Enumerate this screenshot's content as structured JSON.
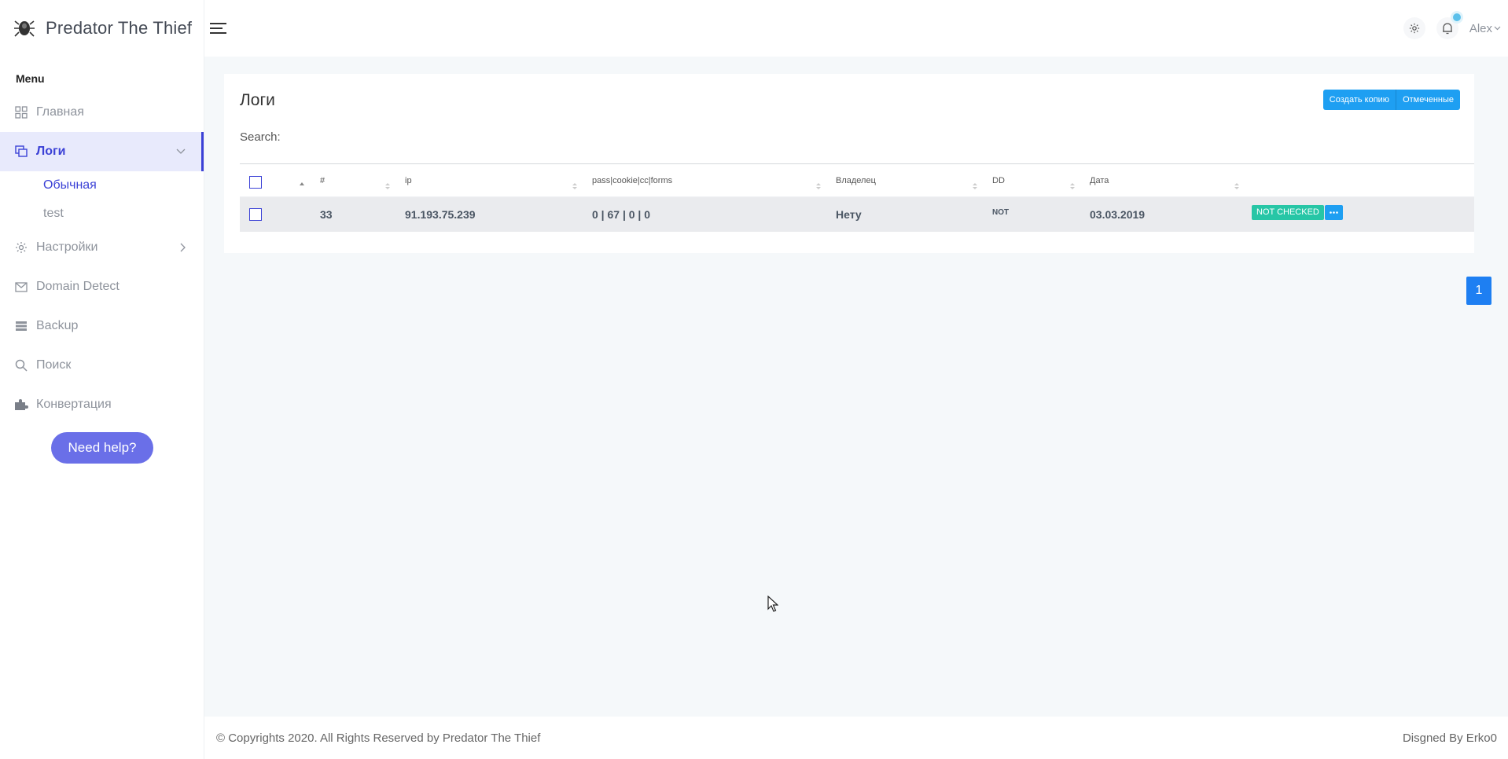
{
  "brand": {
    "name": "Predator The Thief"
  },
  "sidebar": {
    "heading": "Menu",
    "items": [
      {
        "label": "Главная",
        "icon": "grid-icon"
      },
      {
        "label": "Логи",
        "icon": "copy-icon",
        "active": true
      },
      {
        "label": "Настройки",
        "icon": "gear-icon"
      },
      {
        "label": "Domain Detect",
        "icon": "envelope-icon"
      },
      {
        "label": "Backup",
        "icon": "server-icon"
      },
      {
        "label": "Поиск",
        "icon": "search-icon"
      },
      {
        "label": "Конвертация",
        "icon": "puzzle-icon"
      }
    ],
    "submenu": [
      "Обычная",
      "test"
    ],
    "help_label": "Need help?"
  },
  "topbar": {
    "user": "Alex"
  },
  "card": {
    "title": "Логи",
    "buttons": [
      "Создать копию",
      "Отмеченные"
    ],
    "search_label": "Search:"
  },
  "table": {
    "columns": [
      "#",
      "ip",
      "pass|cookie|cc|forms",
      "Владелец",
      "DD",
      "Дата"
    ],
    "rows": [
      {
        "id": "33",
        "ip": "91.193.75.239",
        "stats": "0 | 67 | 0 | 0",
        "owner": "Нету",
        "dd": "NOT",
        "date": "03.03.2019",
        "status": "NOT CHECKED"
      }
    ]
  },
  "pagination": {
    "current": "1"
  },
  "footer": {
    "left": "© Copyrights 2020. All Rights Reserved by Predator The Thief",
    "right": "Disgned By Erko0"
  },
  "colors": {
    "accent": "#3b41d6",
    "primary_button": "#1e9ff2",
    "badge": "#27c6a6",
    "help_button": "#6a6fe8"
  }
}
